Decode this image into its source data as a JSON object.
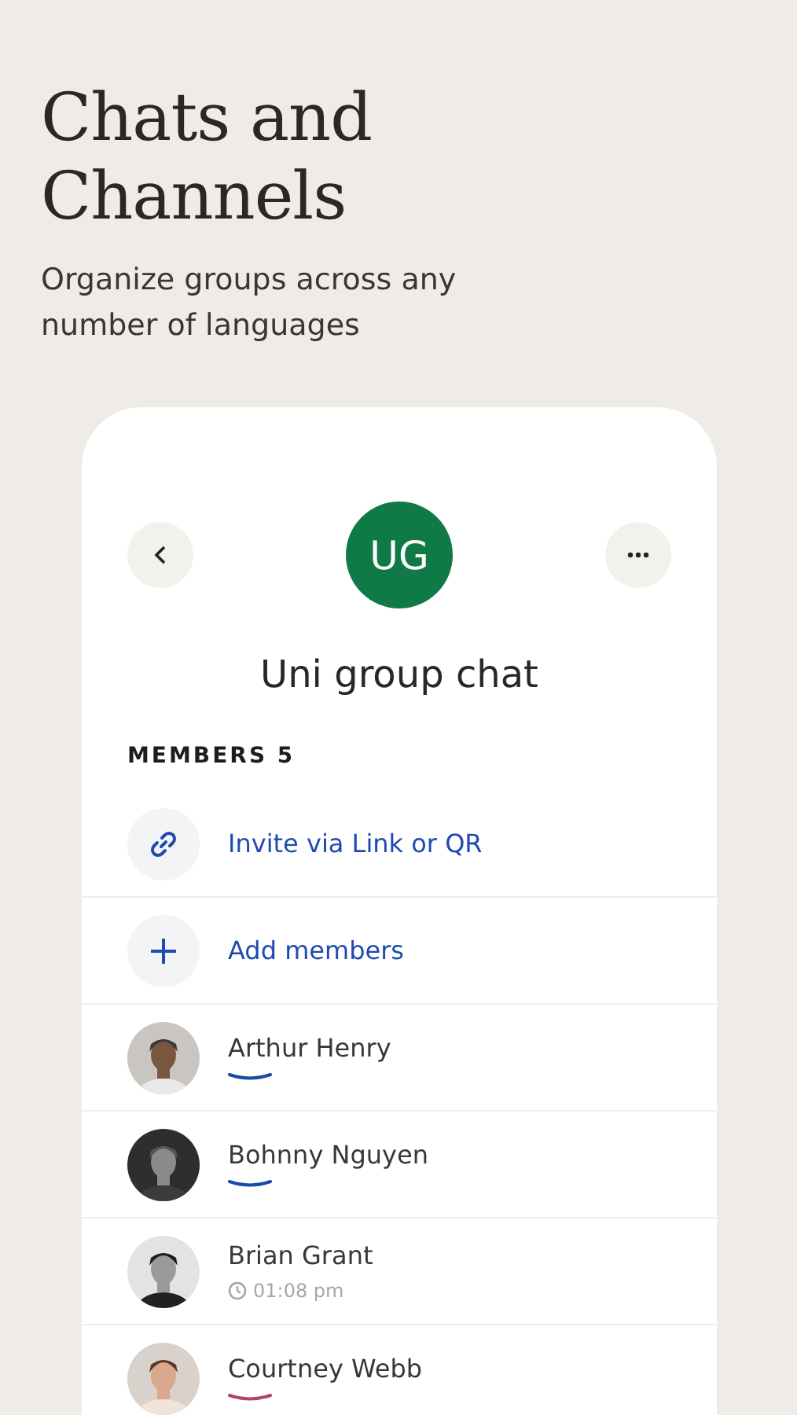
{
  "headline": "Chats and Channels",
  "subtitle": "Organize groups across any number of languages",
  "chat": {
    "initials": "UG",
    "name": "Uni group chat",
    "members_label": "MEMBERS 5"
  },
  "actions": [
    {
      "kind": "link",
      "label": "Invite via Link or QR"
    },
    {
      "kind": "add",
      "label": "Add members"
    }
  ],
  "members": [
    {
      "name": "Arthur Henry",
      "status": {
        "kind": "arc",
        "color": "#1a4aa8"
      }
    },
    {
      "name": "Bohnny Nguyen",
      "status": {
        "kind": "arc",
        "color": "#1a4aa8"
      }
    },
    {
      "name": "Brian Grant",
      "status": {
        "kind": "time",
        "text": "01:08 pm"
      }
    },
    {
      "name": "Courtney Webb",
      "status": {
        "kind": "arc",
        "color": "#b2426a"
      }
    }
  ]
}
